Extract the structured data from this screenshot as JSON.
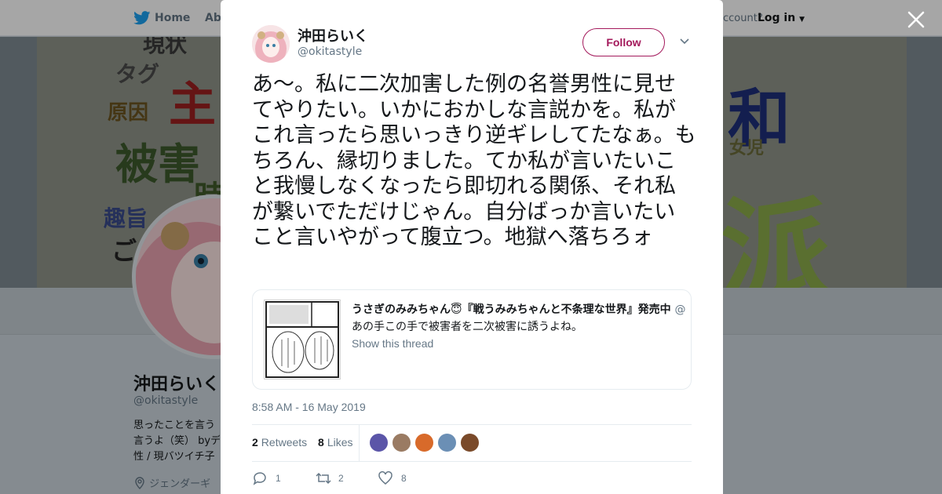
{
  "nav": {
    "home_label": "Home",
    "about_label": "Abo",
    "account_prompt": "ccount?",
    "login_label": "Log in"
  },
  "banner": {
    "words": [
      "現状",
      "タグ",
      "原因",
      "主",
      "被害",
      "時",
      "趣旨",
      "ご",
      "和",
      "女児",
      "派"
    ]
  },
  "profile": {
    "name": "沖田らいく",
    "handle": "@okitastyle",
    "bio_lines": [
      "思ったことを言う",
      "言うよ（笑） byデ",
      "性 / 現バツイチ子"
    ],
    "location": "ジェンダーギ"
  },
  "tweet": {
    "author_name": "沖田らいく",
    "author_handle": "@okitastyle",
    "follow_label": "Follow",
    "text": "あ〜。私に二次加害した例の名誉男性に見せてやりたい。いかにおかしな言説かを。私がこれ言ったら思いっきり逆ギレしてたなぁ。もちろん、縁切りました。てか私が言いたいこと我慢しなくなったら即切れる関係、それ私が繋いでただけじゃん。自分ばっか言いたいこと言いやがって腹立つ。地獄へ落ちろォ",
    "timestamp": "8:58 AM - 16 May 2019",
    "retweets_count": "2",
    "retweets_label": "Retweets",
    "likes_count": "8",
    "likes_label": "Likes",
    "reply_count": "1",
    "retweet_action_count": "2",
    "like_action_count": "8"
  },
  "quote": {
    "user_name": "うさぎのみみちゃん😇『戦うみみちゃんと不条理な世界』発売中",
    "user_handle": "@",
    "text": "あの手この手で被害者を二次被害に誘うよね。",
    "show_thread": "Show this thread"
  },
  "colors": {
    "accent": "#a3195b",
    "twitter_blue": "#1da1f2",
    "secondary_text": "#657786",
    "primary_text": "#14171a"
  }
}
